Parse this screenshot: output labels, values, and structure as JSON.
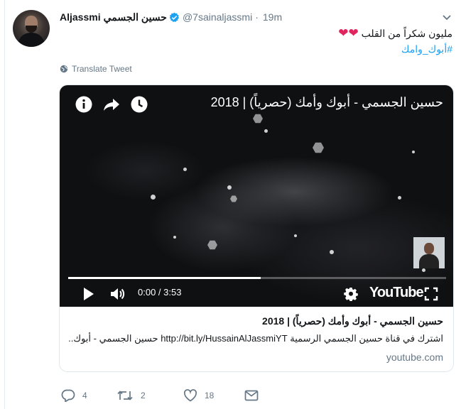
{
  "tweet": {
    "display_name": "Aljassmi",
    "arabic_name": "حسين الجسمي",
    "handle": "@7sainaljassmi",
    "time": "19m",
    "text": "مليون شكراً من القلب",
    "hearts": "❤❤",
    "hashtag": "#أبوك_وامك",
    "translate_label": "Translate Tweet"
  },
  "card": {
    "video_title": "حسين الجسمي - أبوك وأمك (حصرياً) | 2018",
    "timecode": "0:00 / 3:53",
    "progress": 0.51,
    "youtube_label": "YouTube",
    "title": "حسين الجسمي - أبوك وأمك (حصرياً) | 2018",
    "description": "اشترك في قناة حسين الجسمي الرسمية http://bit.ly/HussainAlJassmiYT حسين الجسمي - أبوك..",
    "domain": "youtube.com"
  },
  "actions": {
    "replies": "4",
    "retweets": "2",
    "likes": "18"
  },
  "colors": {
    "link": "#1da1f2",
    "muted": "#657786",
    "heart": "#e0245e",
    "verified": "#1da1f2"
  }
}
